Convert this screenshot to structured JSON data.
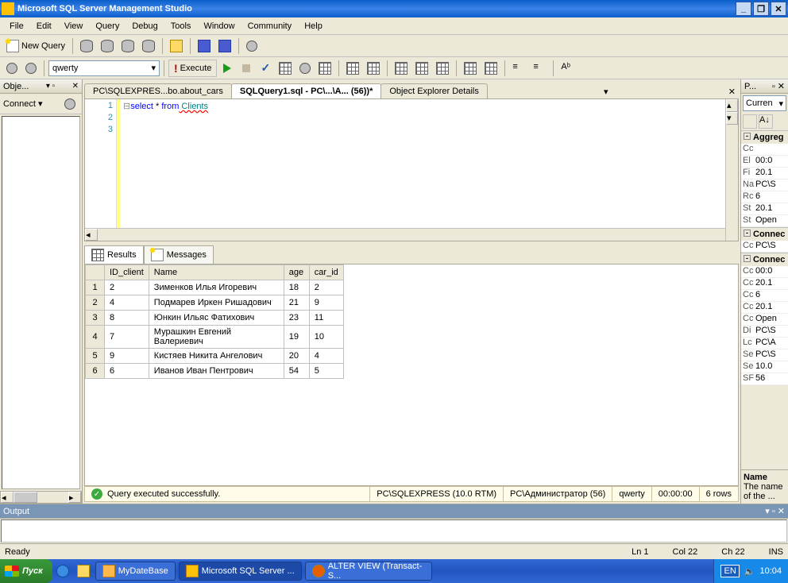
{
  "title": "Microsoft SQL Server Management Studio",
  "menu": [
    "File",
    "Edit",
    "View",
    "Query",
    "Debug",
    "Tools",
    "Window",
    "Community",
    "Help"
  ],
  "toolbar1": {
    "new_query": "New Query"
  },
  "toolbar2": {
    "database": "qwerty",
    "execute": "Execute"
  },
  "left_pane": {
    "title": "Obje...",
    "connect": "Connect"
  },
  "doc_tabs": [
    {
      "label": "PC\\SQLEXPRES...bo.about_cars",
      "active": false
    },
    {
      "label": "SQLQuery1.sql - PC\\...\\A... (56))*",
      "active": true
    },
    {
      "label": "Object Explorer Details",
      "active": false
    }
  ],
  "code": {
    "lines": [
      "1",
      "2",
      "3"
    ],
    "text_select": "select",
    "text_star": " * ",
    "text_from": "from",
    "text_table": " Clients"
  },
  "result_tabs": {
    "results": "Results",
    "messages": "Messages"
  },
  "columns": [
    "ID_client",
    "Name",
    "age",
    "car_id"
  ],
  "rows": [
    {
      "n": "1",
      "id": "2",
      "name": "Зименков Илья Игоревич",
      "age": "18",
      "car": "2"
    },
    {
      "n": "2",
      "id": "4",
      "name": "Подмарев Иркен Ришадович",
      "age": "21",
      "car": "9"
    },
    {
      "n": "3",
      "id": "8",
      "name": "Юнкин Ильяс Фатихович",
      "age": "23",
      "car": "11"
    },
    {
      "n": "4",
      "id": "7",
      "name": "Мурашкин Евгений Валериевич",
      "age": "19",
      "car": "10"
    },
    {
      "n": "5",
      "id": "9",
      "name": "Кистяев Никита Ангелович",
      "age": "20",
      "car": "4"
    },
    {
      "n": "6",
      "id": "6",
      "name": "Иванов Иван Пентрович",
      "age": "54",
      "car": "5"
    }
  ],
  "query_status": {
    "msg": "Query executed successfully.",
    "server": "PC\\SQLEXPRESS (10.0 RTM)",
    "user": "PC\\Администратор (56)",
    "db": "qwerty",
    "time": "00:00:00",
    "rows": "6 rows"
  },
  "properties": {
    "title": "P...",
    "combo": "Curren",
    "cat_agg": "Aggreg",
    "agg_rows": [
      {
        "k": "Cc",
        "v": ""
      },
      {
        "k": "El",
        "v": "00:0"
      },
      {
        "k": "Fi",
        "v": "20.1"
      },
      {
        "k": "Na",
        "v": "PC\\S"
      },
      {
        "k": "Rc",
        "v": "6"
      },
      {
        "k": "St",
        "v": "20.1"
      },
      {
        "k": "St",
        "v": "Open"
      }
    ],
    "cat_conn": "Connec",
    "conn_rows": [
      {
        "k": "Cc",
        "v": "PC\\S"
      }
    ],
    "cat_conn2": "Connec",
    "conn2_rows": [
      {
        "k": "Cc",
        "v": "00:0"
      },
      {
        "k": "Cc",
        "v": "20.1"
      },
      {
        "k": "Cc",
        "v": "6"
      },
      {
        "k": "Cc",
        "v": "20.1"
      },
      {
        "k": "Cc",
        "v": "Open"
      },
      {
        "k": "Di",
        "v": "PC\\S"
      },
      {
        "k": "Lc",
        "v": "PC\\A"
      },
      {
        "k": "Se",
        "v": "PC\\S"
      },
      {
        "k": "Se",
        "v": "10.0"
      },
      {
        "k": "SF",
        "v": "56"
      }
    ],
    "desc_name": "Name",
    "desc_text": "The name of the ..."
  },
  "output": {
    "title": "Output"
  },
  "statusbar": {
    "ready": "Ready",
    "ln": "Ln 1",
    "col": "Col 22",
    "ch": "Ch 22",
    "ins": "INS"
  },
  "taskbar": {
    "start": "Пуск",
    "tabs": [
      {
        "label": "MyDateBase",
        "active": false
      },
      {
        "label": "Microsoft SQL Server ...",
        "active": true
      },
      {
        "label": "ALTER VIEW (Transact-S...",
        "active": false
      }
    ],
    "lang": "EN",
    "clock": "10:04"
  }
}
